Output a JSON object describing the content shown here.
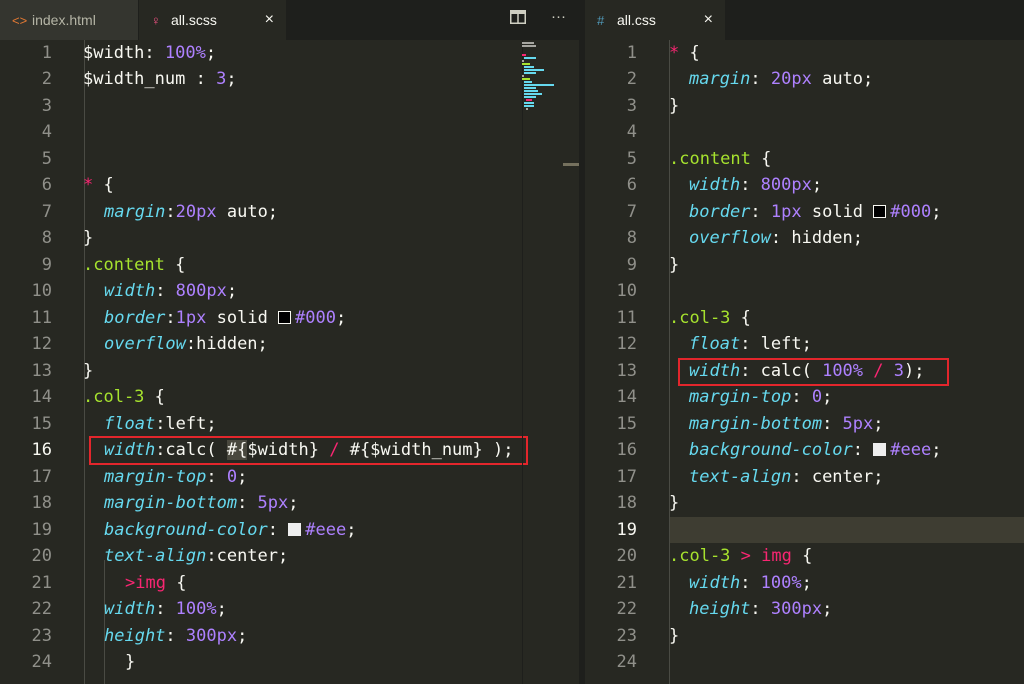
{
  "tabs_left": [
    {
      "label": "index.html",
      "icon": "code-icon",
      "active": false
    },
    {
      "label": "all.scss",
      "icon": "sass-icon",
      "active": true,
      "close": "×"
    }
  ],
  "toolbar_left": {
    "split": "split-editor-icon",
    "more": "···"
  },
  "tabs_right": [
    {
      "label": "all.css",
      "icon": "#",
      "active": true,
      "close": "×"
    }
  ],
  "left_line_numbers": [
    "1",
    "2",
    "3",
    "4",
    "5",
    "6",
    "7",
    "8",
    "9",
    "10",
    "11",
    "12",
    "13",
    "14",
    "15",
    "16",
    "17",
    "18",
    "19",
    "20",
    "21",
    "22",
    "23",
    "24"
  ],
  "right_line_numbers": [
    "1",
    "2",
    "3",
    "4",
    "5",
    "6",
    "7",
    "8",
    "9",
    "10",
    "11",
    "12",
    "13",
    "14",
    "15",
    "16",
    "17",
    "18",
    "19",
    "20",
    "21",
    "22",
    "23",
    "24"
  ],
  "left_code": {
    "l1a": "$width",
    "l1b": ": ",
    "l1c": "100%",
    "l1d": ";",
    "l2a": "$width_num",
    "l2b": " : ",
    "l2c": "3",
    "l2d": ";",
    "l6a": "*",
    "l6b": " {",
    "l7a": "margin",
    "l7b": ":",
    "l7c": "20px",
    "l7d": " auto;",
    "l8": "}",
    "l9a": ".content",
    "l9b": " {",
    "l10a": "width",
    "l10b": ": ",
    "l10c": "800px",
    "l10d": ";",
    "l11a": "border",
    "l11b": ":",
    "l11c": "1px",
    "l11d": " solid ",
    "l11e": "#000",
    "l11f": ";",
    "l12a": "overflow",
    "l12b": ":hidden;",
    "l13": "}",
    "l14a": ".col-3",
    "l14b": " {",
    "l15a": "float",
    "l15b": ":left;",
    "l16a": "width",
    "l16b": ":calc( ",
    "l16c": "#{",
    "l16d": "$width} ",
    "l16e": "/",
    "l16f": " #{$width_num} );",
    "l17a": "margin-top",
    "l17b": ": ",
    "l17c": "0",
    "l17d": ";",
    "l18a": "margin-bottom",
    "l18b": ": ",
    "l18c": "5px",
    "l18d": ";",
    "l19a": "background-color",
    "l19b": ": ",
    "l19c": "#eee",
    "l19d": ";",
    "l20a": "text-align",
    "l20b": ":center;",
    "l21a": ">",
    "l21b": "img",
    "l21c": " {",
    "l22a": "width",
    "l22b": ": ",
    "l22c": "100%",
    "l22d": ";",
    "l23a": "height",
    "l23b": ": ",
    "l23c": "300px",
    "l23d": ";",
    "l24": "}"
  },
  "right_code": {
    "l1a": "*",
    "l1b": " {",
    "l2a": "margin",
    "l2b": ": ",
    "l2c": "20px",
    "l2d": " auto;",
    "l3": "}",
    "l5a": ".content",
    "l5b": " {",
    "l6a": "width",
    "l6b": ": ",
    "l6c": "800px",
    "l6d": ";",
    "l7a": "border",
    "l7b": ": ",
    "l7c": "1px",
    "l7d": " solid ",
    "l7e": "#000",
    "l7f": ";",
    "l8a": "overflow",
    "l8b": ": hidden;",
    "l9": "}",
    "l11a": ".col-3",
    "l11b": " {",
    "l12a": "float",
    "l12b": ": left;",
    "l13a": "width",
    "l13b": ": calc( ",
    "l13c": "100%",
    "l13d": " / ",
    "l13e": "3",
    "l13f": ");",
    "l14a": "margin-top",
    "l14b": ": ",
    "l14c": "0",
    "l14d": ";",
    "l15a": "margin-bottom",
    "l15b": ": ",
    "l15c": "5px",
    "l15d": ";",
    "l16a": "background-color",
    "l16b": ": ",
    "l16c": "#eee",
    "l16d": ";",
    "l17a": "text-align",
    "l17b": ": center;",
    "l18": "}",
    "l20a": ".col-3",
    "l20b": " > ",
    "l20c": "img",
    "l20d": " {",
    "l21a": "width",
    "l21b": ": ",
    "l21c": "100%",
    "l21d": ";",
    "l22a": "height",
    "l22b": ": ",
    "l22c": "300px",
    "l22d": ";",
    "l23": "}"
  },
  "colors": {
    "background": "#272822",
    "pink": "#f92672",
    "green": "#a6e22e",
    "blue": "#66d9ef",
    "purple": "#ae81ff",
    "highlight_box": "#e3262c"
  }
}
